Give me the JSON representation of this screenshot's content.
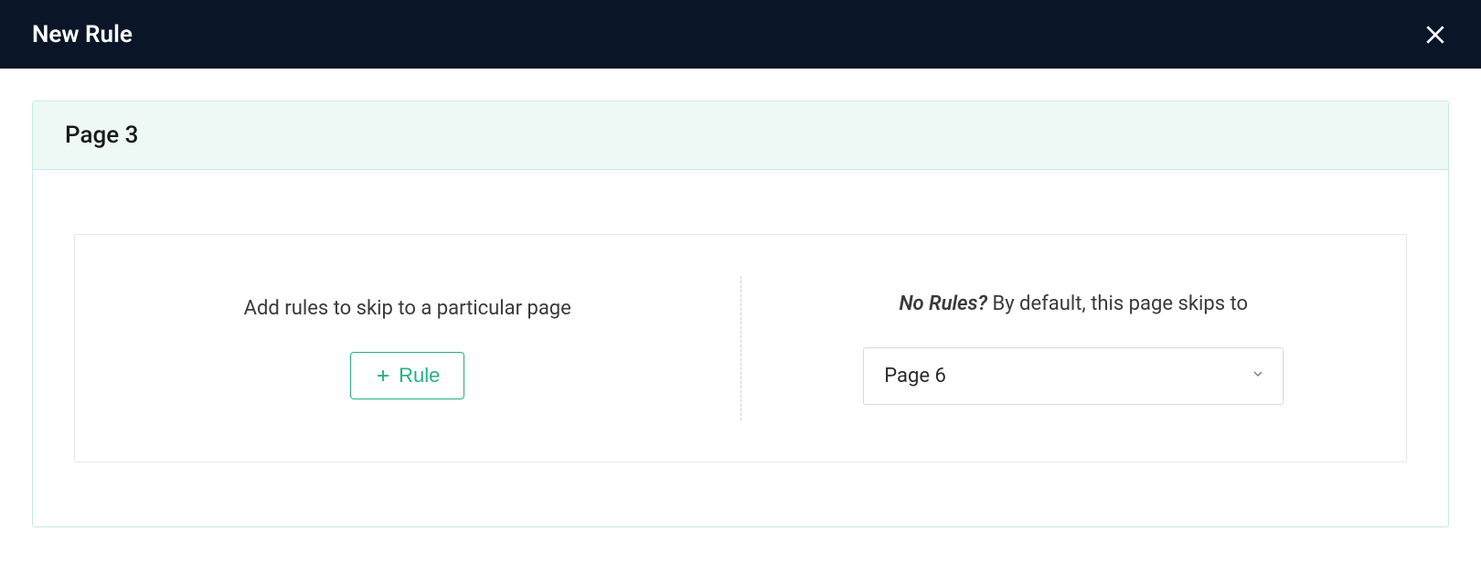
{
  "header": {
    "title": "New Rule"
  },
  "card": {
    "title": "Page 3"
  },
  "left": {
    "label": "Add rules to skip to a particular page",
    "button_label": "Rule"
  },
  "right": {
    "prefix": "No Rules?",
    "suffix": " By default, this page skips to",
    "selected": "Page 6"
  }
}
